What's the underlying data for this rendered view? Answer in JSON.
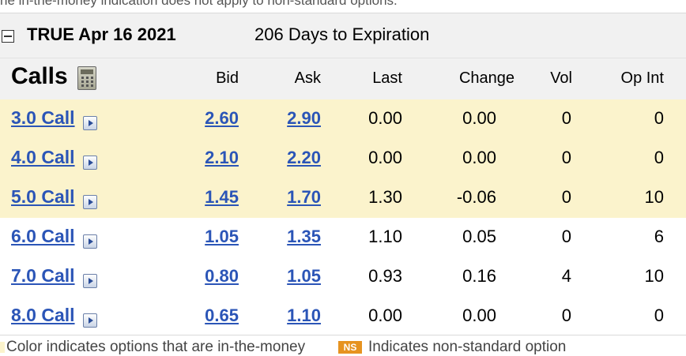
{
  "top_note": "he in-the-money indication does not apply to non-standard options.",
  "expiration": {
    "title": "TRUE Apr 16 2021",
    "days": "206 Days to Expiration"
  },
  "table": {
    "title": "Calls",
    "columns": [
      "Bid",
      "Ask",
      "Last",
      "Change",
      "Vol",
      "Op Int"
    ],
    "rows": [
      {
        "strike": "3.0 Call",
        "bid": "2.60",
        "ask": "2.90",
        "last": "0.00",
        "change": "0.00",
        "vol": "0",
        "op_int": "0",
        "in_the_money": true
      },
      {
        "strike": "4.0 Call",
        "bid": "2.10",
        "ask": "2.20",
        "last": "0.00",
        "change": "0.00",
        "vol": "0",
        "op_int": "0",
        "in_the_money": true
      },
      {
        "strike": "5.0 Call",
        "bid": "1.45",
        "ask": "1.70",
        "last": "1.30",
        "change": "-0.06",
        "vol": "0",
        "op_int": "10",
        "in_the_money": true
      },
      {
        "strike": "6.0 Call",
        "bid": "1.05",
        "ask": "1.35",
        "last": "1.10",
        "change": "0.05",
        "vol": "0",
        "op_int": "6",
        "in_the_money": false
      },
      {
        "strike": "7.0 Call",
        "bid": "0.80",
        "ask": "1.05",
        "last": "0.93",
        "change": "0.16",
        "vol": "4",
        "op_int": "10",
        "in_the_money": false
      },
      {
        "strike": "8.0 Call",
        "bid": "0.65",
        "ask": "1.10",
        "last": "0.00",
        "change": "0.00",
        "vol": "0",
        "op_int": "0",
        "in_the_money": false
      }
    ]
  },
  "legend": {
    "itm_text": "Color indicates options that are in-the-money",
    "ns_badge": "NS",
    "ns_text": "Indicates non-standard option"
  },
  "colors": {
    "itm_background": "#fbf3cc",
    "link": "#2b55b7",
    "header_background": "#f1f1f1",
    "ns_badge": "#e69320"
  },
  "icons": {
    "collapse": "minus-box-icon",
    "calculator": "calculator-icon",
    "row_menu": "triangle-right-icon"
  }
}
